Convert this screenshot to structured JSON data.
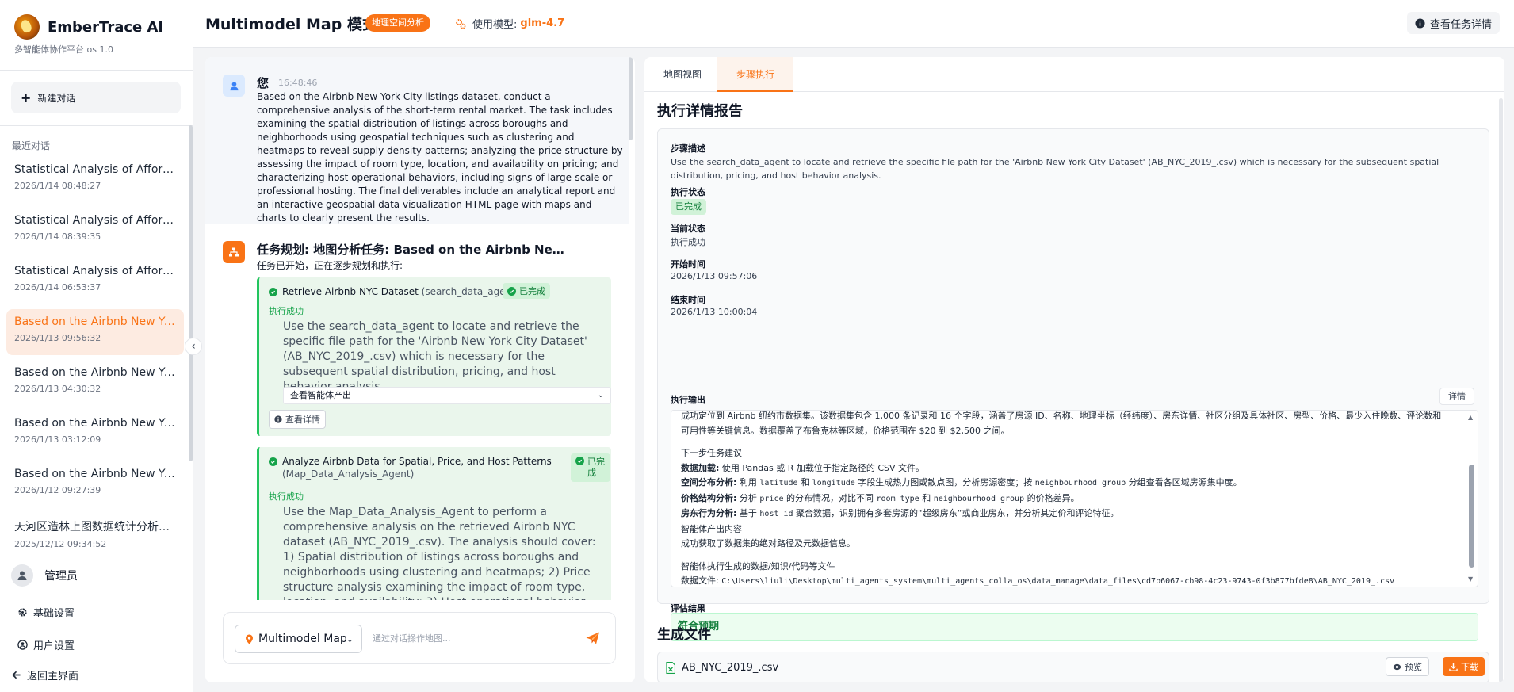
{
  "brand": {
    "name": "EmberTrace AI",
    "subtitle": "多智能体协作平台 os 1.0"
  },
  "sidebar": {
    "new_chat_label": "新建对话",
    "recent_title": "最近对话",
    "conversations": [
      {
        "title": "Statistical Analysis of Afforestation",
        "date": "2026/1/14 08:48:27"
      },
      {
        "title": "Statistical Analysis of Afforestation",
        "date": "2026/1/14 08:39:35"
      },
      {
        "title": "Statistical Analysis of Afforestation",
        "date": "2026/1/14 06:53:37"
      },
      {
        "title": "Based on the Airbnb New York City",
        "date": "2026/1/13 09:56:32"
      },
      {
        "title": "Based on the Airbnb New York City",
        "date": "2026/1/13 04:30:32"
      },
      {
        "title": "Based on the Airbnb New York City",
        "date": "2026/1/13 03:12:09"
      },
      {
        "title": "Based on the Airbnb New York City",
        "date": "2026/1/12 09:27:39"
      },
      {
        "title": "天河区造林上图数据统计分析及可视化",
        "date": "2025/12/12 09:34:52"
      }
    ],
    "user_name": "管理员",
    "basic_settings": "基础设置",
    "user_settings": "用户设置",
    "back_home": "返回主界面"
  },
  "header": {
    "title": "Multimodel Map 模式",
    "badge": "地理空间分析",
    "model_label": "使用模型:",
    "model_value": "glm-4.7",
    "detail_button": "查看任务详情"
  },
  "chat": {
    "user_message": {
      "sender": "您",
      "time": "16:48:46",
      "text": "Based on the Airbnb New York City listings dataset, conduct a comprehensive analysis of the short-term rental market. The task includes examining the spatial distribution of listings across boroughs and neighborhoods using geospatial techniques such as clustering and heatmaps to reveal supply density patterns; analyzing the price structure by assessing the impact of room type, location, and availability on pricing; and characterizing host operational behaviors, including signs of large-scale or professional hosting. The final deliverables include an analytical report and an interactive geospatial data visualization HTML page with maps and charts to clearly present the results."
    },
    "plan": {
      "title": "任务规划: 地图分析任务: Based on the Airbnb New York City listings dataset",
      "subtitle": "任务已开始，正在逐步规划和执行:",
      "steps": [
        {
          "name": "Retrieve Airbnb NYC Dataset",
          "agent": "(search_data_agent)",
          "badge": "已完成",
          "status": "执行成功",
          "description": "Use the search_data_agent to locate and retrieve the specific file path for the 'Airbnb New York City Dataset' (AB_NYC_2019_.csv) which is necessary for the subsequent spatial distribution, pricing, and host behavior analysis.",
          "output_select": "查看智能体产出",
          "detail_button": "查看详情"
        },
        {
          "name": "Analyze Airbnb Data for Spatial, Price, and Host Patterns",
          "agent": "(Map_Data_Analysis_Agent)",
          "badge": "已完成",
          "status": "执行成功",
          "description": "Use the Map_Data_Analysis_Agent to perform a comprehensive analysis on the retrieved Airbnb NYC dataset (AB_NYC_2019_.csv). The analysis should cover: 1) Spatial distribution of listings across boroughs and neighborhoods using clustering and heatmaps; 2) Price structure analysis examining the impact of room type, location, and availability; 3) Host operational behavior characterization to identify signs of large-scale or professional hosting."
        }
      ]
    },
    "input": {
      "mode": "Multimodel Map",
      "placeholder": "通过对话操作地图..."
    }
  },
  "tabs": [
    "地图视图",
    "步骤执行"
  ],
  "report": {
    "title": "执行详情报告",
    "step_desc_label": "步骤描述",
    "step_desc": "Use the search_data_agent to locate and retrieve the specific file path for the 'Airbnb New York City Dataset' (AB_NYC_2019_.csv) which is necessary for the subsequent spatial distribution, pricing, and host behavior analysis.",
    "exec_status_label": "执行状态",
    "exec_status": "已完成",
    "current_status_label": "当前状态",
    "current_status": "执行成功",
    "start_label": "开始时间",
    "start_time": "2026/1/13 09:57:06",
    "end_label": "结束时间",
    "end_time": "2026/1/13 10:00:04",
    "output_label": "执行输出",
    "output_detail_button": "详情",
    "output": {
      "summary_1": "成功定位到 Airbnb 纽约市数据集。该数据集包含 1,000 条记录和 16 个字段，涵盖了房源 ID、名称、地理坐标（经纬度）、房东详情、社区分组及具体社区、房型、价格、最少入住晚数、评论数和",
      "summary_2": "可用性等关键信息。数据覆盖了布鲁克林等区域，价格范围在 $20 到 $2,500 之间。",
      "next_title": "下一步任务建议",
      "load_label": "数据加载:",
      "load_text": " 使用 Pandas 或 R 加载位于指定路径的 CSV 文件。",
      "spatial_label": "空间分布分析:",
      "spatial_a": " 利用 ",
      "spatial_code1": "latitude",
      "spatial_b": " 和 ",
      "spatial_code2": "longitude",
      "spatial_c": " 字段生成热力图或散点图，分析房源密度；按 ",
      "spatial_code3": "neighbourhood_group",
      "spatial_d": " 分组查看各区域房源集中度。",
      "price_label": "价格结构分析:",
      "price_a": " 分析 ",
      "price_code1": "price",
      "price_b": " 的分布情况，对比不同 ",
      "price_code2": "room_type",
      "price_c": " 和 ",
      "price_code3": "neighbourhood_group",
      "price_d": " 的价格差异。",
      "host_label": "房东行为分析:",
      "host_a": " 基于 ",
      "host_code1": "host_id",
      "host_b": " 聚合数据，识别拥有多套房源的“超级房东”或商业房东，并分析其定价和评论特征。",
      "agent_out_title": "智能体产出内容",
      "agent_out_text": "成功获取了数据集的绝对路径及元数据信息。",
      "gen_title": "智能体执行生成的数据/知识/代码等文件",
      "data_file_label": "数据文件: ",
      "data_file_path": "C:\\Users\\liuli\\Desktop\\multi_agents_system\\multi_agents_colla_os\\data_manage\\data_files\\cd7b6067-cb98-4c23-9743-0f3b877bfde8\\AB_NYC_2019_.csv"
    },
    "eval_label": "评估结果",
    "eval_value": "符合预期"
  },
  "files": {
    "title": "生成文件",
    "items": [
      {
        "name": "AB_NYC_2019_.csv",
        "preview": "预览",
        "download": "下载"
      }
    ]
  },
  "colors": {
    "accent": "#f97316",
    "success": "#16a34a",
    "success_bg": "#eaf6ec"
  }
}
